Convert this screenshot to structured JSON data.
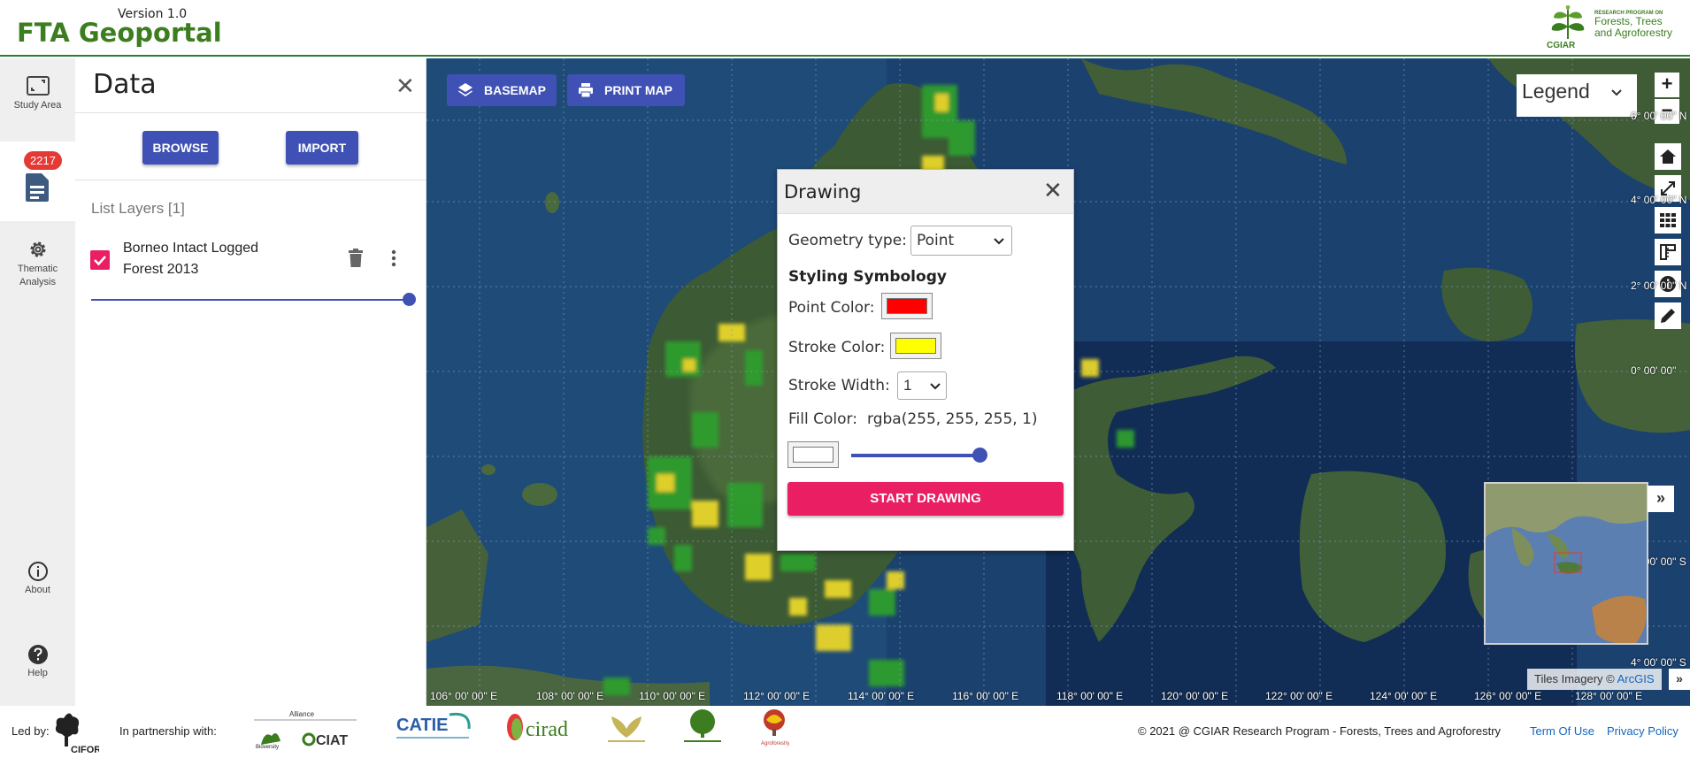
{
  "header": {
    "version": "Version 1.0",
    "title": "FTA Geoportal",
    "logo": {
      "cgiar": "CGIAR",
      "program_small": "RESEARCH PROGRAM ON",
      "program_name": "Forests, Trees and Agroforestry"
    }
  },
  "rail": {
    "items": [
      {
        "label": "Study Area",
        "icon": "study-area-icon"
      },
      {
        "label": "",
        "icon": "document-icon",
        "badge": "2217"
      },
      {
        "label": "Thematic Analysis",
        "icon": "gear-icon"
      },
      {
        "label": "About",
        "icon": "info-icon"
      },
      {
        "label": "Help",
        "icon": "help-icon"
      }
    ]
  },
  "panel": {
    "title": "Data",
    "close_icon": "close-icon",
    "browse_label": "BROWSE",
    "import_label": "IMPORT",
    "list_title": "List Layers [1]",
    "layers": [
      {
        "name": "Borneo Intact Logged Forest 2013",
        "checked": true,
        "opacity": 1.0
      }
    ]
  },
  "map": {
    "basemap_label": "BASEMAP",
    "print_label": "PRINT MAP",
    "legend_label": "Legend",
    "zoom_in": "+",
    "zoom_out": "−",
    "tools": [
      "home-icon",
      "fullscreen-icon",
      "grid-icon",
      "measure-icon",
      "identify-info-icon",
      "draw-pencil-icon"
    ],
    "lat_labels": [
      "6° 00' 00\" N",
      "4° 00' 00\" N",
      "2° 00' 00\" N",
      "0° 00' 00\"",
      "2° 00' 00\" S",
      "4° 00' 00\" S"
    ],
    "lon_labels": [
      "106° 00' 00\" E",
      "108° 00' 00\" E",
      "110° 00' 00\" E",
      "112° 00' 00\" E",
      "114° 00' 00\" E",
      "116° 00' 00\" E",
      "118° 00' 00\" E",
      "120° 00' 00\" E",
      "122° 00' 00\" E",
      "124° 00' 00\" E",
      "126° 00' 00\" E",
      "128° 00' 00\" E"
    ],
    "attribution_prefix": "Tiles Imagery © ",
    "attribution_link": "ArcGIS",
    "overview_toggle": "»",
    "attribution_toggle": "»"
  },
  "drawing": {
    "title": "Drawing",
    "geometry_label": "Geometry type:",
    "geometry_value": "Point",
    "styling_title": "Styling Symbology",
    "point_color_label": "Point Color:",
    "point_color": "#ff0000",
    "stroke_color_label": "Stroke Color:",
    "stroke_color": "#ffff00",
    "stroke_width_label": "Stroke Width:",
    "stroke_width_value": "1",
    "fill_color_label": "Fill Color:",
    "fill_color_value": "rgba(255, 255, 255, 1)",
    "fill_color": "#ffffff",
    "fill_opacity": 1.0,
    "start_label": "START DRAWING"
  },
  "footer": {
    "led_by": "Led by:",
    "led_by_logo": "CIFOR",
    "partnership": "In partnership with:",
    "partner_logos": [
      "Alliance Bioversity CIAT",
      "CATIE",
      "cirad",
      "ICRAF",
      "INBAR",
      "World Agroforestry"
    ],
    "copyright": "© 2021 @ CGIAR Research Program - Forests, Trees and Agroforestry",
    "terms": "Term Of Use",
    "privacy": "Privacy Policy"
  },
  "colors": {
    "brand_green": "#3b7d1f",
    "primary_blue": "#3f51b5",
    "accent_pink": "#e91e63",
    "badge_red": "#e53935"
  }
}
